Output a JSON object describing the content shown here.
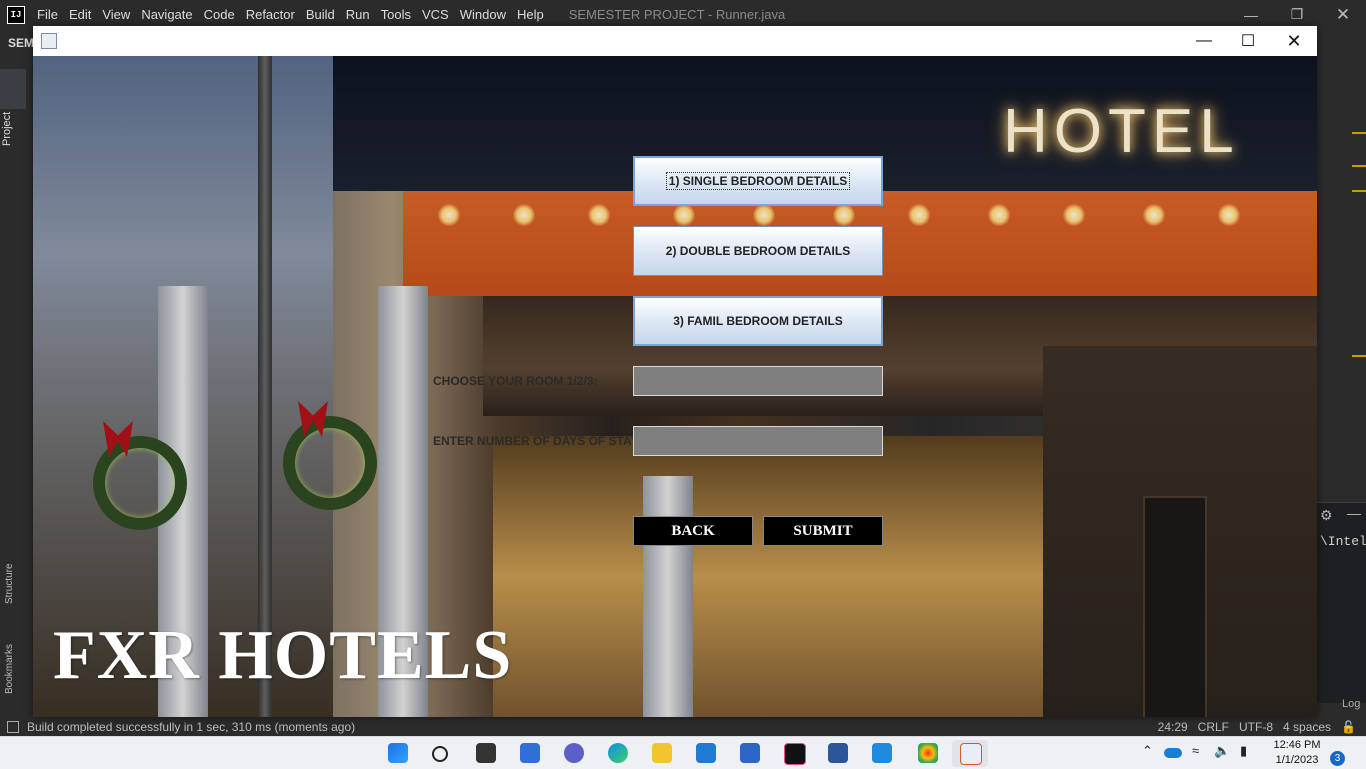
{
  "ide": {
    "menu": [
      "File",
      "Edit",
      "View",
      "Navigate",
      "Code",
      "Refactor",
      "Build",
      "Run",
      "Tools",
      "VCS",
      "Window",
      "Help"
    ],
    "window_title": "SEMESTER PROJECT - Runner.java",
    "project_short": "SEM",
    "sidebar_tabs": {
      "project": "Project",
      "structure": "Structure",
      "bookmarks": "Bookmarks"
    },
    "right_panel_text": "\\Intel",
    "right_panel_log": "Log",
    "status": {
      "message": "Build completed successfully in 1 sec, 310 ms (moments ago)",
      "position": "24:29",
      "line_ending": "CRLF",
      "encoding": "UTF-8",
      "indent": "4 spaces"
    }
  },
  "app": {
    "buttons": {
      "single": "1) SINGLE BEDROOM DETAILS",
      "double": "2) DOUBLE BEDROOM DETAILS",
      "family": "3) FAMIL BEDROOM DETAILS",
      "back": "BACK",
      "submit": "SUBMIT"
    },
    "form": {
      "room_label": "CHOOSE YOUR ROOM 1/2/3:",
      "room_value": "",
      "days_label": "ENTER NUMBER OF DAYS OF STAY:",
      "days_value": ""
    },
    "brand": "FXR HOTELS",
    "sign_text": "HOTEL"
  },
  "taskbar": {
    "time": "12:46 PM",
    "date": "1/1/2023",
    "notification_count": "3"
  }
}
